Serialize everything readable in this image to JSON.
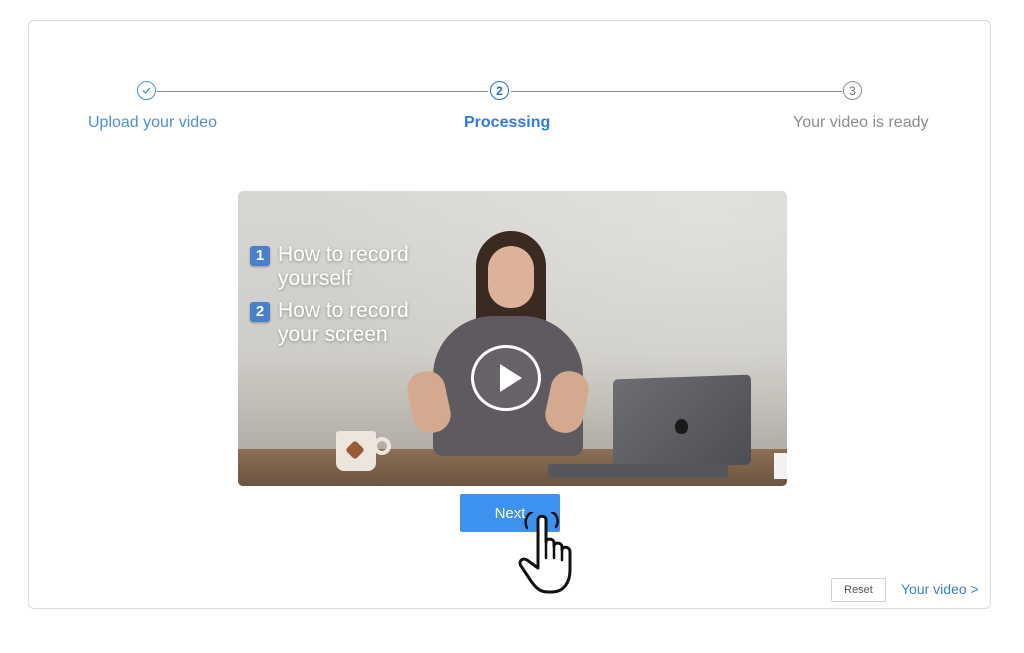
{
  "stepper": {
    "steps": [
      {
        "number": "",
        "label": "Upload your video",
        "status": "done",
        "icon": "check-icon"
      },
      {
        "number": "2",
        "label": "Processing",
        "status": "active"
      },
      {
        "number": "3",
        "label": "Your video is ready",
        "status": "pending"
      }
    ]
  },
  "video": {
    "overlay_items": [
      {
        "number": "1",
        "text": "How to record\nyourself"
      },
      {
        "number": "2",
        "text": "How to record\nyour screen"
      }
    ],
    "play_icon": "play-icon"
  },
  "actions": {
    "next_label": "Next",
    "reset_label": "Reset",
    "your_video_label": "Your video >"
  },
  "colors": {
    "accent": "#3d92f0",
    "step_done": "#4a8fe0",
    "step_active": "#1f6fd6",
    "step_pending": "#8c8c8c"
  }
}
